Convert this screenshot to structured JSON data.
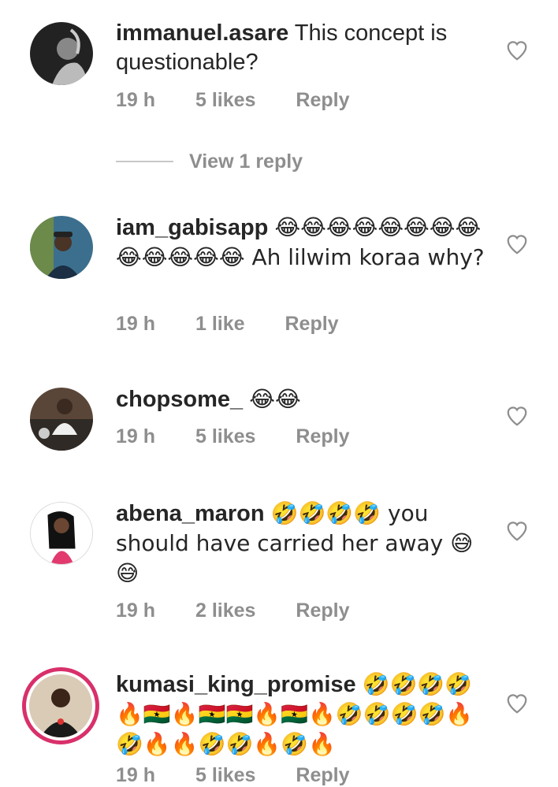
{
  "comments": [
    {
      "username": "immanuel.asare",
      "text": "This concept is questionable?",
      "time": "19 h",
      "likes": "5 likes",
      "reply": "Reply",
      "view_replies": "View 1 reply"
    },
    {
      "username": "iam_gabisapp",
      "text": "😂😂😂😂😂😂😂😂😂😂😂😂😂 Ah lilwim koraa why?",
      "time": "19 h",
      "likes": "1 like",
      "reply": "Reply"
    },
    {
      "username": "chopsome_",
      "text": "😂😂",
      "time": "19 h",
      "likes": "5 likes",
      "reply": "Reply"
    },
    {
      "username": "abena_maron",
      "text": "🤣🤣🤣🤣 you should have carried her away 😅😅",
      "time": "19 h",
      "likes": "2 likes",
      "reply": "Reply"
    },
    {
      "username": "kumasi_king_promise",
      "text": "🤣🤣🤣🤣🔥🇬🇭🔥🇬🇭🇬🇭🔥🇬🇭🔥🤣🤣🤣🤣🔥🤣🔥🔥🤣🤣🔥🤣🔥",
      "time": "19 h",
      "likes": "5 likes",
      "reply": "Reply"
    }
  ],
  "icons": {
    "heart": "heart-outline-icon",
    "avatar": "profile-avatar"
  },
  "colors": {
    "text": "#262626",
    "meta": "#8e8e8e",
    "story_ring": "#d8306a"
  }
}
